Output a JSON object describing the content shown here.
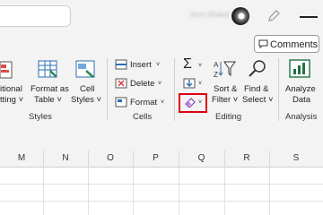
{
  "titlebar": {
    "user_name": "Nem Shakel"
  },
  "comments": {
    "label": "Comments"
  },
  "styles": {
    "conditional_l1": "itional",
    "conditional_l2": "tting ˅",
    "format_table_l1": "Format as",
    "format_table_l2": "Table ˅",
    "cell_styles_l1": "Cell",
    "cell_styles_l2": "Styles ˅",
    "group": "Styles"
  },
  "cells": {
    "insert": "Insert",
    "delete": "Delete",
    "format": "Format",
    "group": "Cells"
  },
  "editing": {
    "sort_l1": "Sort &",
    "sort_l2": "Filter ˅",
    "find_l1": "Find &",
    "find_l2": "Select ˅",
    "group": "Editing"
  },
  "analysis": {
    "l1": "Analyze",
    "l2": "Data",
    "group": "Analysis"
  },
  "columns": [
    "M",
    "N",
    "O",
    "P",
    "Q",
    "R",
    "S"
  ],
  "colors": {
    "accent_green": "#217346",
    "highlight_red": "#e2000f"
  }
}
